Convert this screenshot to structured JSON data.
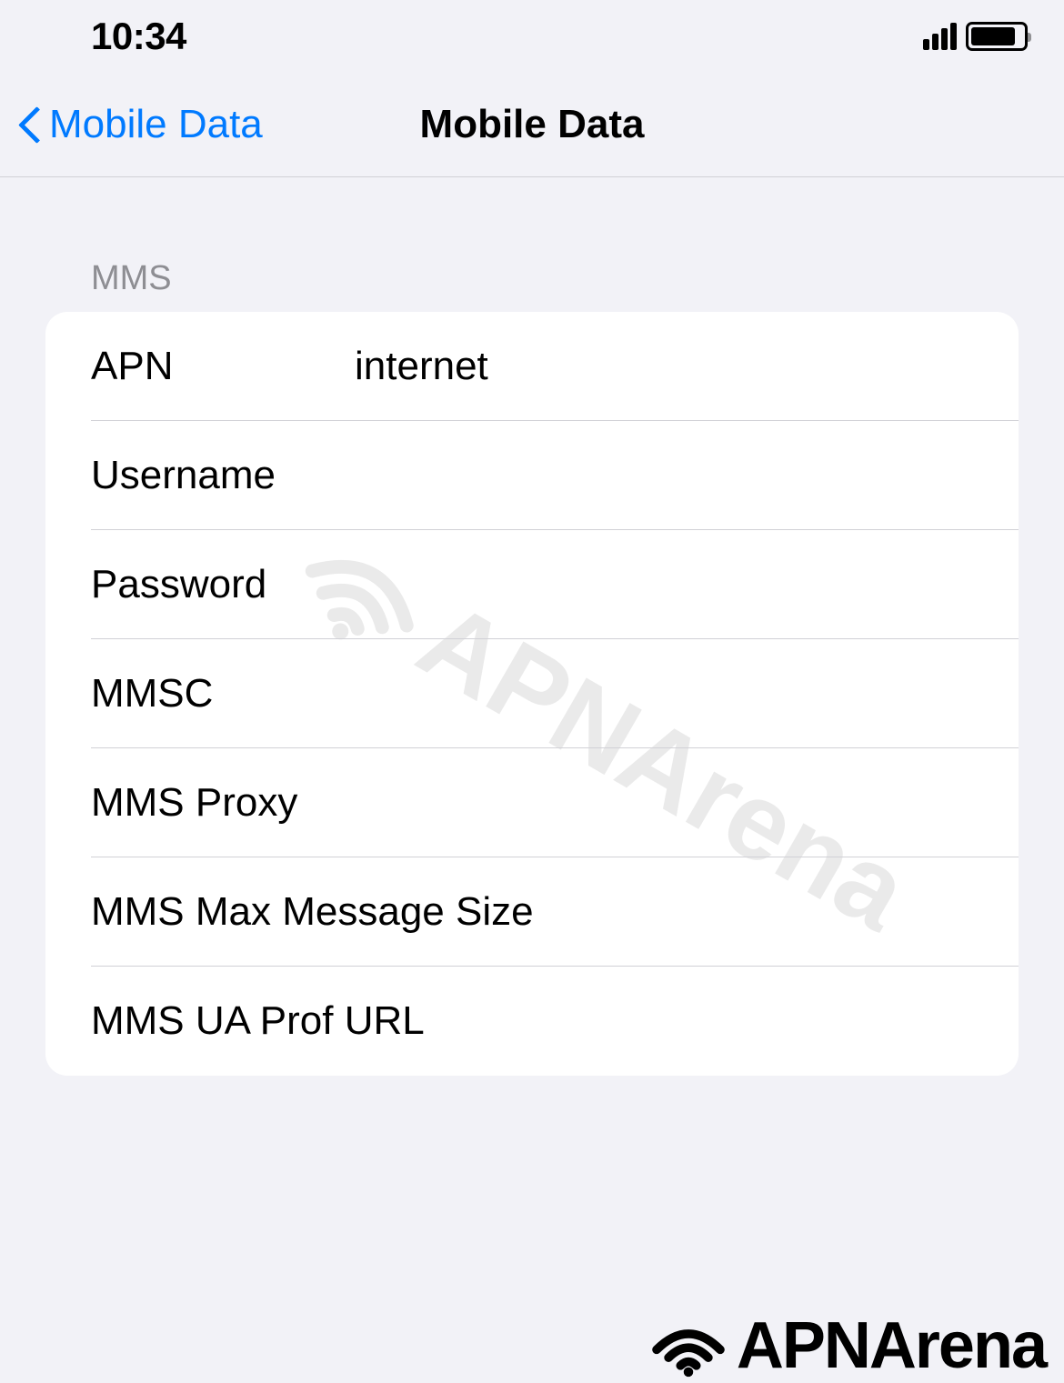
{
  "status_bar": {
    "time": "10:34"
  },
  "nav": {
    "back_label": "Mobile Data",
    "title": "Mobile Data"
  },
  "section": {
    "header": "MMS"
  },
  "fields": {
    "apn": {
      "label": "APN",
      "value": "internet"
    },
    "username": {
      "label": "Username",
      "value": ""
    },
    "password": {
      "label": "Password",
      "value": ""
    },
    "mmsc": {
      "label": "MMSC",
      "value": ""
    },
    "mms_proxy": {
      "label": "MMS Proxy",
      "value": ""
    },
    "mms_max_size": {
      "label": "MMS Max Message Size",
      "value": ""
    },
    "mms_ua_prof": {
      "label": "MMS UA Prof URL",
      "value": ""
    }
  },
  "brand": {
    "name": "APNArena"
  }
}
